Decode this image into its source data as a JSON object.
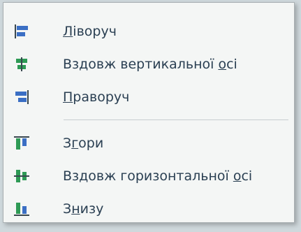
{
  "menu": {
    "items": [
      {
        "pre": "",
        "key": "Л",
        "post": "іворуч",
        "icon": "align-left-icon"
      },
      {
        "pre": "Вздовж вертикальної ",
        "key": "о",
        "post": "сі",
        "icon": "align-center-vertical-axis-icon"
      },
      {
        "pre": "",
        "key": "П",
        "post": "раворуч",
        "icon": "align-right-icon"
      },
      {
        "pre": "З",
        "key": "г",
        "post": "ори",
        "icon": "align-top-icon"
      },
      {
        "pre": "Вздовж горизонтальної ",
        "key": "о",
        "post": "сі",
        "icon": "align-middle-horizontal-axis-icon"
      },
      {
        "pre": "З",
        "key": "н",
        "post": "изу",
        "icon": "align-bottom-icon"
      }
    ]
  },
  "colors": {
    "icon_blue": "#3b6fc4",
    "icon_green": "#2e9a55",
    "icon_axis": "#39474f",
    "text": "#2a3f52"
  }
}
